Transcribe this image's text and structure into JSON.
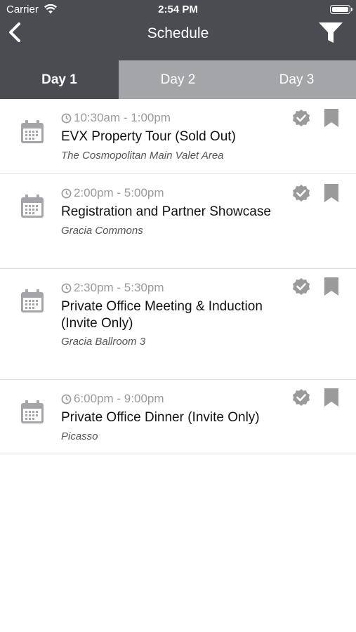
{
  "status_bar": {
    "carrier": "Carrier",
    "time": "2:54 PM"
  },
  "header": {
    "title": "Schedule"
  },
  "tabs": [
    {
      "label": "Day 1",
      "active": true
    },
    {
      "label": "Day 2",
      "active": false
    },
    {
      "label": "Day 3",
      "active": false
    }
  ],
  "events": [
    {
      "time": "10:30am - 1:00pm",
      "title": "EVX Property Tour (Sold Out)",
      "location": "The Cosmopolitan Main Valet Area"
    },
    {
      "time": "2:00pm - 5:00pm",
      "title": "Registration and Partner Showcase",
      "location": "Gracia Commons"
    },
    {
      "time": "2:30pm - 5:30pm",
      "title": "Private Office Meeting & Induction (Invite Only)",
      "location": "Gracia Ballroom 3"
    },
    {
      "time": "6:00pm - 9:00pm",
      "title": "Private Office Dinner (Invite Only)",
      "location": "Picasso"
    }
  ],
  "colors": {
    "header": "#4a4c52",
    "tab_inactive": "#a3a5a8",
    "icon_gray": "#9a9a9a"
  },
  "icons": {
    "back": "chevron-left-icon",
    "filter": "funnel-icon",
    "event": "calendar-icon",
    "time": "clock-icon",
    "attend": "check-badge-icon",
    "save": "bookmark-icon"
  }
}
